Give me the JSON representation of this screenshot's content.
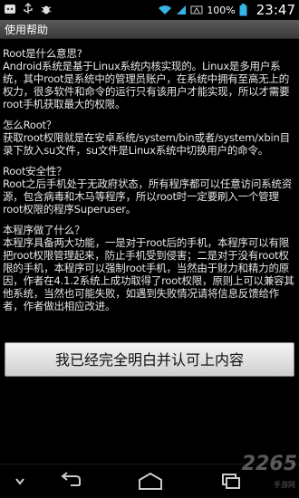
{
  "status_bar": {
    "battery_percent": "100%",
    "time": "23:47"
  },
  "title_bar": {
    "title": "使用帮助"
  },
  "help": {
    "sections": [
      {
        "heading": "Root是什么意思?",
        "body": "Android系统是基于Linux系统内核实现的。Linux是多用户系统，其中root是系统中的管理员账户，在系统中拥有至高无上的权力，很多软件和命令的运行只有该用户才能实现，所以才需要root手机获取最大的权限。"
      },
      {
        "heading": "怎么Root？",
        "body": "获取root权限就是在安卓系统/system/bin或者/system/xbin目录下放入su文件，su文件是Linux系统中切换用户的命令。"
      },
      {
        "heading": "Root安全性？",
        "body": "Root之后手机处于无政府状态，所有程序都可以任意访问系统资源，包含病毒和木马等程序，所以root时一定要刷入一个管理root权限的程序Superuser。"
      },
      {
        "heading": "本程序做了什么？",
        "body": "本程序具备两大功能，一是对于root后的手机，本程序可以有限把root权限管理起来，防止手机受到侵害；二是对于没有root权限的手机，本程序可以强制root手机，当然由于财力和精力的原因，作者在4.1.2系统上成功取得了root权限，原则上可以兼容其他系统，当然也可能失败，如遇到失败情况请将信息反馈给作者，作者做出相应改进。"
      }
    ]
  },
  "confirm_button": {
    "label": "我已经完全明白并认可上内容"
  },
  "watermark": {
    "logo": "2265",
    "sub": "手游网"
  }
}
